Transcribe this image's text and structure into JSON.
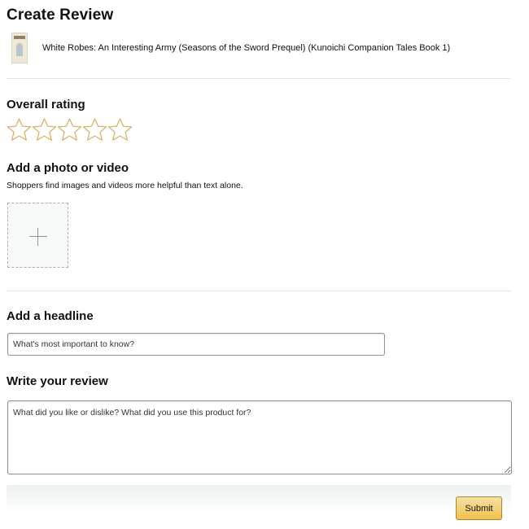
{
  "page": {
    "title": "Create Review"
  },
  "product": {
    "title": "White Robes: An Interesting Army (Seasons of the Sword Prequel) (Kunoichi Companion Tales Book 1)"
  },
  "rating": {
    "heading": "Overall rating",
    "max_stars": 5,
    "selected": 0,
    "star_outline_color": "#d5b46a"
  },
  "media": {
    "heading": "Add a photo or video",
    "subtext": "Shoppers find images and videos more helpful than text alone.",
    "icon": "plus-icon"
  },
  "headline": {
    "heading": "Add a headline",
    "placeholder": "What's most important to know?",
    "value": ""
  },
  "review": {
    "heading": "Write your review",
    "placeholder": "What did you like or dislike? What did you use this product for?",
    "value": ""
  },
  "footer": {
    "submit_label": "Submit",
    "submit_color": "#f0c14b"
  }
}
